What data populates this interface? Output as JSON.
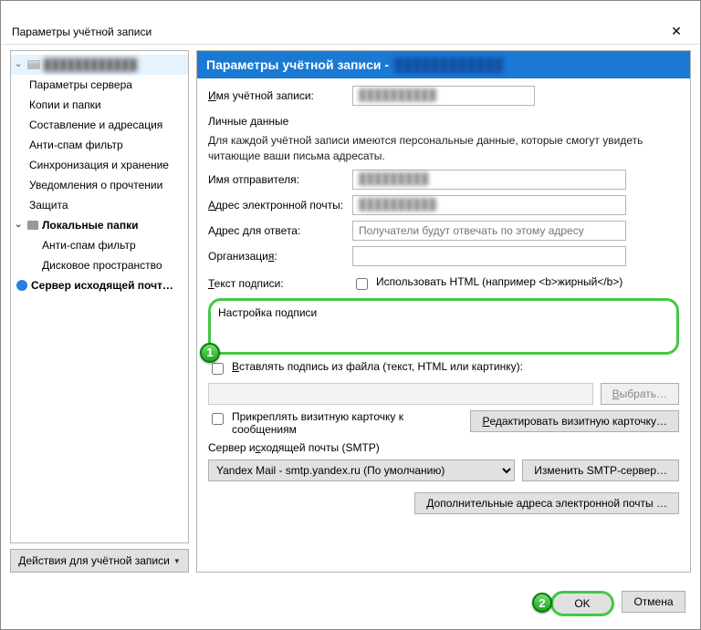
{
  "window": {
    "title": "Параметры учётной записи"
  },
  "sidebar": {
    "account_blur": "████████████",
    "items": [
      "Параметры сервера",
      "Копии и папки",
      "Составление и адресация",
      "Анти-спам фильтр",
      "Синхронизация и хранение",
      "Уведомления о прочтении",
      "Защита"
    ],
    "local_folders": "Локальные папки",
    "local_items": [
      "Анти-спам фильтр",
      "Дисковое пространство"
    ],
    "outgoing": "Сервер исходящей почт…",
    "actions_btn": "Действия для учётной записи"
  },
  "banner": {
    "title": "Параметры учётной записи -",
    "account_blur": "████████████"
  },
  "main": {
    "account_name_label": "Имя учётной записи:",
    "account_name_value": "██████████",
    "personal_title": "Личные данные",
    "personal_desc": "Для каждой учётной записи имеются персональные данные, которые смогут увидеть читающие ваши письма адресаты.",
    "sender_name_label": "Имя отправителя:",
    "sender_name_value": "█████████",
    "email_label": "Адрес электронной почты:",
    "email_value": "██████████",
    "reply_label": "Адрес для ответа:",
    "reply_placeholder": "Получатели будут отвечать по этому адресу",
    "org_label": "Организация:",
    "sig_label": "Текст подписи:",
    "html_cb": "Использовать HTML (например <b>жирный</b>)",
    "sig_value": "Настройка подписи",
    "sig_file_cb": "Вставлять подпись из файла (текст, HTML или картинку):",
    "browse_btn": "Выбрать…",
    "vcard_cb": "Прикреплять визитную карточку к сообщениям",
    "vcard_btn": "Редактировать визитную карточку…",
    "smtp_label": "Сервер исходящей почты (SMTP)",
    "smtp_value": "Yandex Mail - smtp.yandex.ru (По умолчанию)",
    "smtp_btn": "Изменить SMTP-сервер…",
    "extra_btn": "Дополнительные адреса электронной почты …"
  },
  "footer": {
    "ok": "OK",
    "cancel": "Отмена"
  },
  "callouts": {
    "one": "1",
    "two": "2"
  }
}
